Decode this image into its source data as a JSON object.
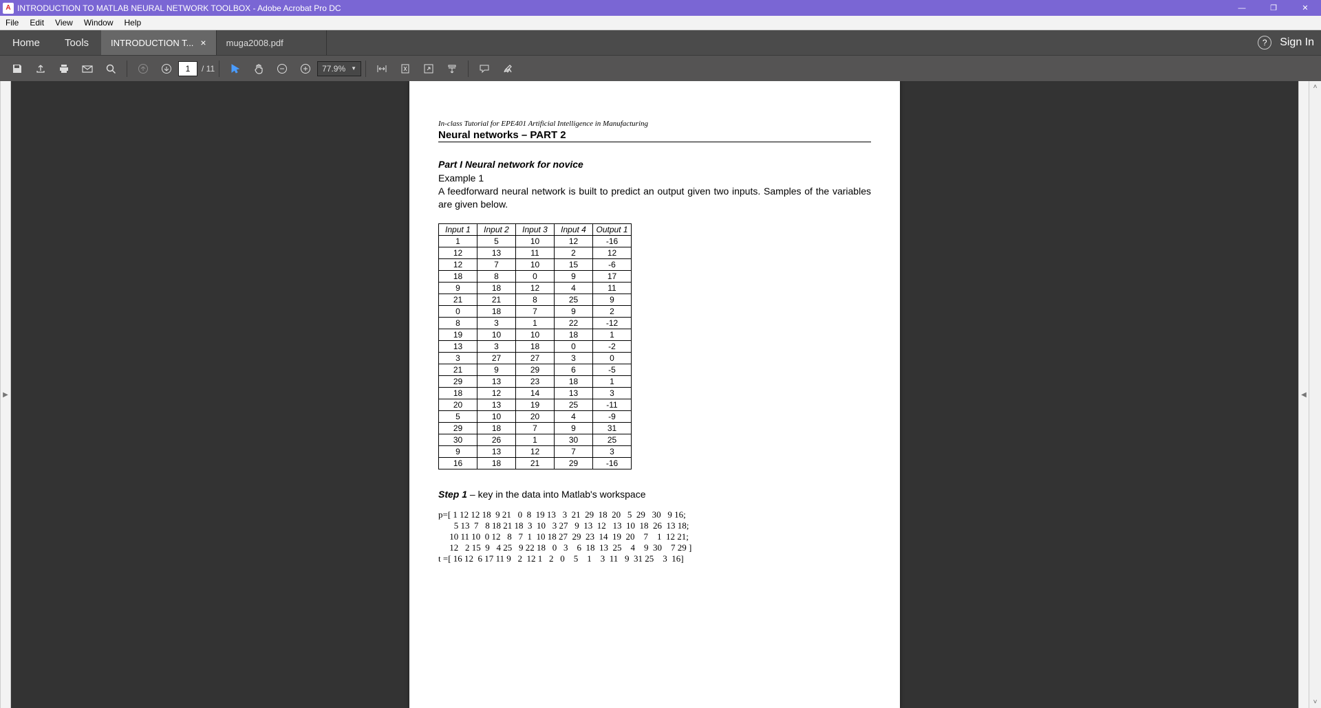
{
  "window": {
    "title": "INTRODUCTION TO MATLAB NEURAL NETWORK TOOLBOX - Adobe Acrobat Pro DC",
    "minimize": "—",
    "maximize": "❐",
    "close": "✕"
  },
  "menubar": {
    "items": [
      "File",
      "Edit",
      "View",
      "Window",
      "Help"
    ]
  },
  "tabsbar": {
    "home": "Home",
    "tools": "Tools",
    "tabs": [
      {
        "label": "INTRODUCTION T...",
        "active": true,
        "close": "×"
      },
      {
        "label": "muga2008.pdf",
        "active": false
      }
    ],
    "help": "?",
    "signin": "Sign In"
  },
  "toolbar": {
    "page_current": "1",
    "page_total": "/ 11",
    "zoom": "77.9%"
  },
  "document": {
    "tutorial_line": "In-class Tutorial for EPE401 Artificial Intelligence in Manufacturing",
    "title": "Neural networks – PART 2",
    "part_title": "Part I Neural network for novice",
    "example_label": "Example 1",
    "description": "A feedforward neural network is built to predict an output given two inputs. Samples of the variables are given below.",
    "table": {
      "headers": [
        "Input 1",
        "Input 2",
        "Input 3",
        "Input 4",
        "Output 1"
      ],
      "rows": [
        [
          1,
          5,
          10,
          12,
          -16
        ],
        [
          12,
          13,
          11,
          2,
          12
        ],
        [
          12,
          7,
          10,
          15,
          -6
        ],
        [
          18,
          8,
          0,
          9,
          17
        ],
        [
          9,
          18,
          12,
          4,
          11
        ],
        [
          21,
          21,
          8,
          25,
          9
        ],
        [
          0,
          18,
          7,
          9,
          2
        ],
        [
          8,
          3,
          1,
          22,
          -12
        ],
        [
          19,
          10,
          10,
          18,
          1
        ],
        [
          13,
          3,
          18,
          0,
          -2
        ],
        [
          3,
          27,
          27,
          3,
          0
        ],
        [
          21,
          9,
          29,
          6,
          -5
        ],
        [
          29,
          13,
          23,
          18,
          1
        ],
        [
          18,
          12,
          14,
          13,
          3
        ],
        [
          20,
          13,
          19,
          25,
          -11
        ],
        [
          5,
          10,
          20,
          4,
          -9
        ],
        [
          29,
          18,
          7,
          9,
          31
        ],
        [
          30,
          26,
          1,
          30,
          25
        ],
        [
          9,
          13,
          12,
          7,
          3
        ],
        [
          16,
          18,
          21,
          29,
          -16
        ]
      ]
    },
    "step1_prefix": "Step 1",
    "step1_rest": " – key in the data into Matlab's workspace",
    "code": "p=[ 1 12 12 18  9 21   0  8  19 13   3  21  29  18  20   5  29   30   9 16;\n       5 13  7   8 18 21 18  3  10   3 27   9  13  12   13  10  18  26  13 18;\n     10 11 10  0 12   8   7  1  10 18 27  29  23  14  19  20    7    1  12 21;\n     12   2 15  9   4 25   9 22 18   0   3    6  18  13  25    4    9  30    7 29 ]\nt =[ 16 12  6 17 11 9   2  12 1   2   0    5    1    3  11   9  31 25    3  16]"
  },
  "gutters": {
    "left": "▶",
    "right": "◀",
    "up": "˄",
    "down": "˅"
  }
}
